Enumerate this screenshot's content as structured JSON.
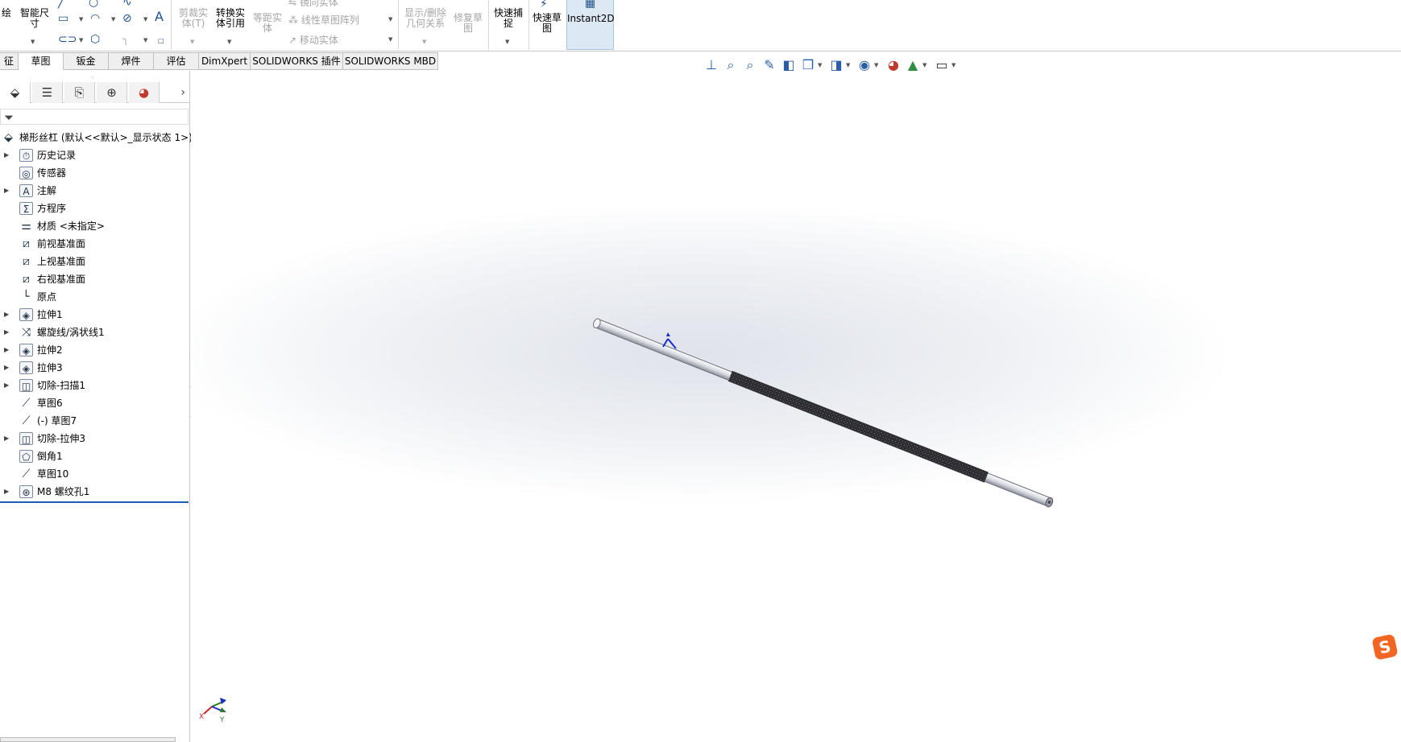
{
  "ribbon": {
    "items": {
      "sketch_edge": "绘",
      "smart_dim": "智能尺寸",
      "trim": "剪裁实体(T)",
      "convert": "转换实体引用",
      "offset": "等距实体",
      "mirror": "镜向实体",
      "linear_pattern": "线性草图阵列",
      "move": "移动实体",
      "display_relations": "显示/删除几何关系",
      "repair": "修复草图",
      "quick_snap": "快速捕捉",
      "rapid_sketch": "快速草图",
      "instant2d": "Instant2D"
    }
  },
  "tabs": [
    {
      "label": "征"
    },
    {
      "label": "草图"
    },
    {
      "label": "钣金"
    },
    {
      "label": "焊件"
    },
    {
      "label": "评估"
    },
    {
      "label": "DimXpert"
    },
    {
      "label": "SOLIDWORKS 插件"
    },
    {
      "label": "SOLIDWORKS MBD"
    }
  ],
  "tree": {
    "root": "梯形丝杠 (默认<<默认>_显示状态 1>)",
    "items": [
      {
        "label": "历史记录",
        "icon": "history-icon",
        "expandable": true
      },
      {
        "label": "传感器",
        "icon": "sensor-icon",
        "expandable": false
      },
      {
        "label": "注解",
        "icon": "annotation-icon",
        "expandable": true
      },
      {
        "label": "方程序",
        "icon": "equation-icon",
        "expandable": false
      },
      {
        "label": "材质 <未指定>",
        "icon": "material-icon",
        "expandable": false
      },
      {
        "label": "前视基准面",
        "icon": "plane-icon",
        "expandable": false
      },
      {
        "label": "上视基准面",
        "icon": "plane-icon",
        "expandable": false
      },
      {
        "label": "右视基准面",
        "icon": "plane-icon",
        "expandable": false
      },
      {
        "label": "原点",
        "icon": "origin-icon",
        "expandable": false
      },
      {
        "label": "拉伸1",
        "icon": "extrude-icon",
        "expandable": true
      },
      {
        "label": "螺旋线/涡状线1",
        "icon": "helix-icon",
        "expandable": true
      },
      {
        "label": "拉伸2",
        "icon": "extrude-icon",
        "expandable": true
      },
      {
        "label": "拉伸3",
        "icon": "extrude-icon",
        "expandable": true
      },
      {
        "label": "切除-扫描1",
        "icon": "sweep-cut-icon",
        "expandable": true
      },
      {
        "label": "草图6",
        "icon": "sketch-icon",
        "expandable": false
      },
      {
        "label": "(-) 草图7",
        "icon": "sketch-icon",
        "expandable": false
      },
      {
        "label": "切除-拉伸3",
        "icon": "cut-extrude-icon",
        "expandable": true
      },
      {
        "label": "倒角1",
        "icon": "chamfer-icon",
        "expandable": false
      },
      {
        "label": "草图10",
        "icon": "sketch-icon",
        "expandable": false
      },
      {
        "label": "M8 螺纹孔1",
        "icon": "hole-icon",
        "expandable": true
      }
    ]
  },
  "triad": {
    "x": "X",
    "y": "Y"
  }
}
